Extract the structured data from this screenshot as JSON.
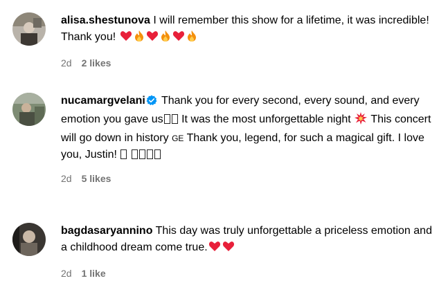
{
  "comments": [
    {
      "username": "alisa.shestunova",
      "verified": false,
      "text_parts": [
        "I will remember this show for a lifetime, it was incredible! Thank you!"
      ],
      "emojis": [
        "heart",
        "fire",
        "heart",
        "fire",
        "heart",
        "fire"
      ],
      "age": "2d",
      "likes": "2 likes"
    },
    {
      "username": "nucamargvelani",
      "verified": true,
      "text_parts": [
        "Thank you for every second, every sound, and every emotion you gave us",
        "It was the most unforgettable night",
        "This concert will go down in history",
        "GE",
        "Thank you, legend, for such a magical gift. I love you, Justin!"
      ],
      "emojis": [
        "collision"
      ],
      "age": "2d",
      "likes": "5 likes"
    },
    {
      "username": "bagdasaryannino",
      "verified": false,
      "text_parts": [
        "This day was truly unforgettable a priceless emotion and a childhood dream come true."
      ],
      "emojis": [
        "heart",
        "heart"
      ],
      "age": "2d",
      "likes": "1 like"
    }
  ],
  "colors": {
    "text": "#000000",
    "meta": "#737373",
    "verified": "#0095f6",
    "heart": "#e8203a",
    "fire": "#f4900c"
  }
}
